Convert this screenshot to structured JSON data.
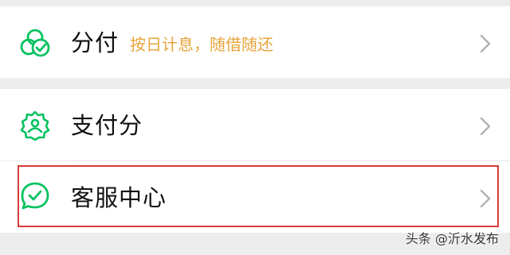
{
  "menu": {
    "items": [
      {
        "label": "分付",
        "subtitle": "按日计息，随借随还",
        "icon": "fen-fu-icon"
      },
      {
        "label": "支付分",
        "icon": "pay-score-icon"
      },
      {
        "label": "客服中心",
        "icon": "customer-service-icon"
      }
    ]
  },
  "watermark": "头条 @沂水发布",
  "colors": {
    "accent_green": "#07c160",
    "subtitle_orange": "#e8a43a",
    "highlight_red": "#d93a3a"
  }
}
